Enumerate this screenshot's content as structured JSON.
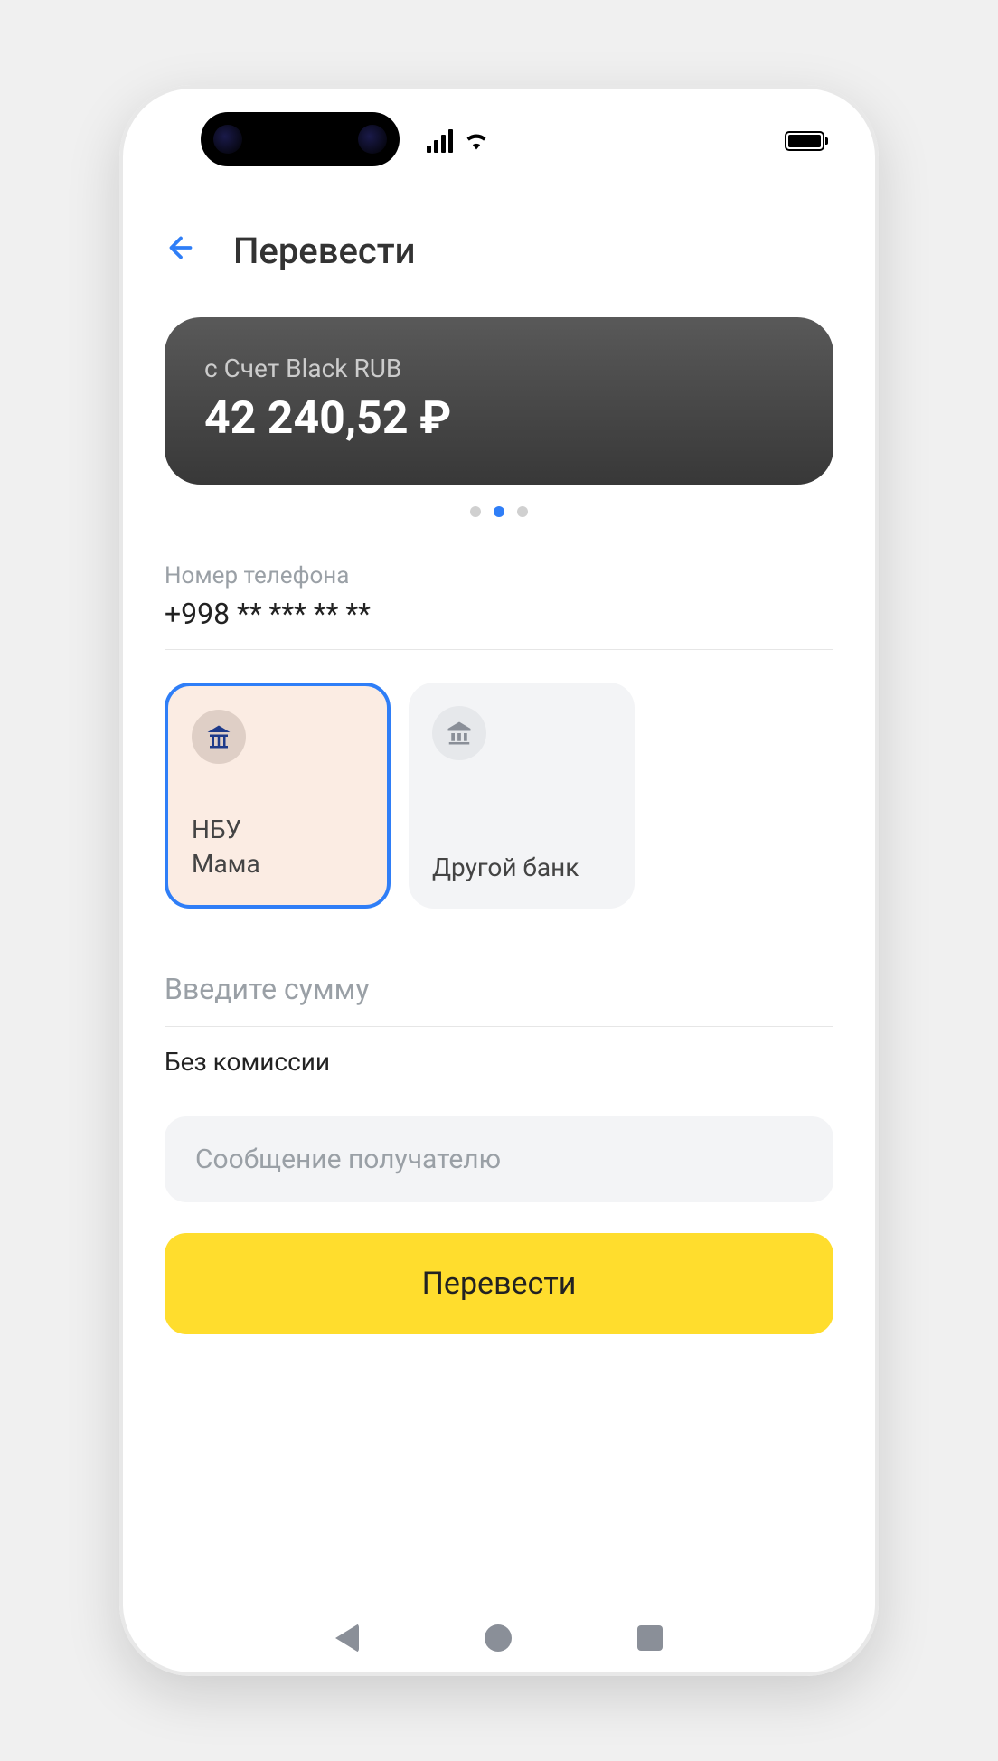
{
  "header": {
    "title": "Перевести"
  },
  "account": {
    "label": "с Счет Black RUB",
    "balance": "42 240,52 ₽"
  },
  "phone": {
    "label": "Номер телефона",
    "value": "+998 ** *** ** **"
  },
  "banks": {
    "selected": {
      "name": "НБУ",
      "contact": "Мама",
      "icon": "bank-building-icon"
    },
    "other": {
      "label": "Другой банк",
      "icon": "bank-generic-icon"
    }
  },
  "amount": {
    "placeholder": "Введите сумму"
  },
  "commission": {
    "text": "Без комиссии"
  },
  "message": {
    "placeholder": "Сообщение получателю"
  },
  "submit": {
    "label": "Перевести"
  },
  "colors": {
    "accent_blue": "#2f7ef7",
    "brand_yellow": "#ffdd2d",
    "card_dark": "#383838",
    "selected_bg": "#fbece3"
  }
}
